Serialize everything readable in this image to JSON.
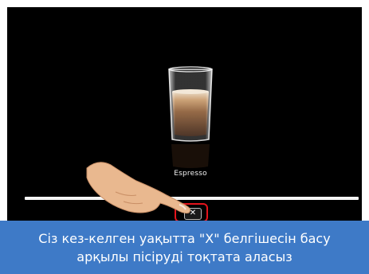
{
  "machine_screen": {
    "drink_name": "Espresso",
    "stop_symbol": "✕",
    "progress_fraction": 1.0
  },
  "caption": {
    "line1": "Сіз кез-келген уақытта \"X\" белгішесін басу",
    "line2": "арқылы пісіруді тоқтата аласыз"
  },
  "colors": {
    "screen_background": "#000000",
    "caption_background": "#3e7ac7",
    "highlight_border": "#e5141c"
  },
  "icons": [
    "espresso-glass-icon",
    "close-icon",
    "pointing-hand-icon"
  ]
}
